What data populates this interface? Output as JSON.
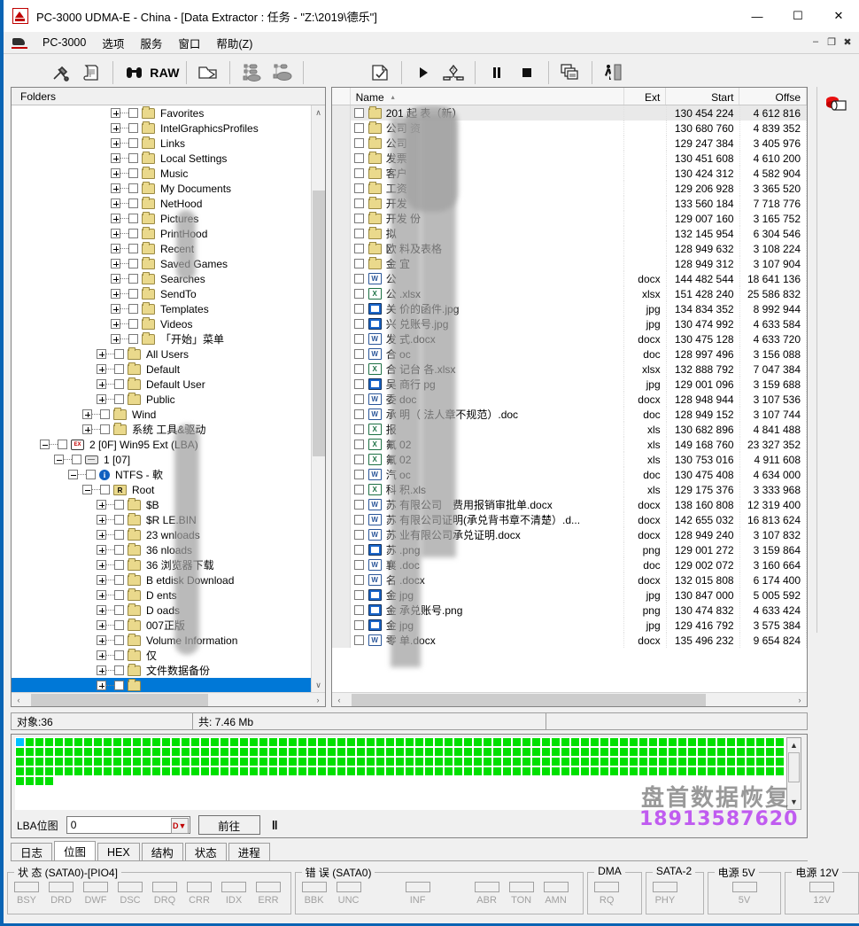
{
  "window": {
    "title": "PC-3000 UDMA-E - China - [Data Extractor : 任务 - \"Z:\\2019\\德乐\"]",
    "app_icon": "pc3000-icon",
    "minimize": "—",
    "maximize": "☐",
    "close": "✕",
    "mdi_minimize": "–",
    "mdi_restore": "❐",
    "mdi_close": "✖"
  },
  "menu": {
    "icon": "pc3000-small-icon",
    "items": [
      {
        "label": "PC-3000",
        "accel": "P"
      },
      {
        "label": "选项",
        "accel": ""
      },
      {
        "label": "服务",
        "accel": ""
      },
      {
        "label": "窗口",
        "accel": ""
      },
      {
        "label": "帮助(Z)",
        "accel": "Z"
      }
    ]
  },
  "toolbar": {
    "buttons": [
      {
        "name": "tools-icon",
        "glyph": "⚒"
      },
      {
        "name": "info-scroll-icon",
        "glyph": "ὍC"
      },
      {
        "name": "sep",
        "glyph": ""
      },
      {
        "name": "binoculars-search-icon",
        "glyph": "AA"
      },
      {
        "name": "raw-button",
        "glyph": "RAW"
      },
      {
        "name": "sep",
        "glyph": ""
      },
      {
        "name": "open-folder-icon",
        "glyph": "⬚"
      },
      {
        "name": "sep",
        "glyph": ""
      },
      {
        "name": "tree-map-icon",
        "glyph": ""
      },
      {
        "name": "tree-map-alt-icon",
        "glyph": ""
      },
      {
        "name": "sep",
        "glyph": ""
      },
      {
        "name": "task-document-icon",
        "glyph": ""
      },
      {
        "name": "sep",
        "glyph": ""
      },
      {
        "name": "play-icon",
        "glyph": "▶"
      },
      {
        "name": "branch-icon",
        "glyph": ""
      },
      {
        "name": "sep",
        "glyph": ""
      },
      {
        "name": "pause-icon",
        "glyph": "‖"
      },
      {
        "name": "stop-icon",
        "glyph": "■"
      },
      {
        "name": "sep",
        "glyph": ""
      },
      {
        "name": "windows-cascade-icon",
        "glyph": ""
      },
      {
        "name": "sep",
        "glyph": ""
      },
      {
        "name": "exit-icon",
        "glyph": ""
      }
    ],
    "raw_label": "RAW"
  },
  "right_rail": {
    "items": [
      {
        "name": "disk-drive-red-icon"
      }
    ]
  },
  "tree": {
    "header": "Folders",
    "rows": [
      {
        "indent": 7,
        "exp": "plus",
        "icon": "folder",
        "label": "Favorites"
      },
      {
        "indent": 7,
        "exp": "plus",
        "icon": "folder",
        "label": "IntelGraphicsProfiles"
      },
      {
        "indent": 7,
        "exp": "plus",
        "icon": "folder",
        "label": "Links"
      },
      {
        "indent": 7,
        "exp": "plus",
        "icon": "folder",
        "label": "Local Settings"
      },
      {
        "indent": 7,
        "exp": "plus",
        "icon": "folder",
        "label": "Music"
      },
      {
        "indent": 7,
        "exp": "plus",
        "icon": "folder",
        "label": "My Documents"
      },
      {
        "indent": 7,
        "exp": "plus",
        "icon": "folder",
        "label": "NetHood"
      },
      {
        "indent": 7,
        "exp": "plus",
        "icon": "folder",
        "label": "Pictures"
      },
      {
        "indent": 7,
        "exp": "plus",
        "icon": "folder",
        "label": "PrintHood"
      },
      {
        "indent": 7,
        "exp": "plus",
        "icon": "folder",
        "label": "Recent"
      },
      {
        "indent": 7,
        "exp": "plus",
        "icon": "folder",
        "label": "Saved Games"
      },
      {
        "indent": 7,
        "exp": "plus",
        "icon": "folder",
        "label": "Searches"
      },
      {
        "indent": 7,
        "exp": "plus",
        "icon": "folder",
        "label": "SendTo"
      },
      {
        "indent": 7,
        "exp": "plus",
        "icon": "folder",
        "label": "Templates"
      },
      {
        "indent": 7,
        "exp": "plus",
        "icon": "folder",
        "label": "Videos"
      },
      {
        "indent": 7,
        "exp": "plus",
        "icon": "folder",
        "label": "「开始」菜单"
      },
      {
        "indent": 6,
        "exp": "plus",
        "icon": "folder",
        "label": "All Users"
      },
      {
        "indent": 6,
        "exp": "plus",
        "icon": "folder",
        "label": "Default"
      },
      {
        "indent": 6,
        "exp": "plus",
        "icon": "folder",
        "label": "Default User"
      },
      {
        "indent": 6,
        "exp": "plus",
        "icon": "folder",
        "label": "Public"
      },
      {
        "indent": 5,
        "exp": "plus",
        "icon": "folder",
        "label": "Wind"
      },
      {
        "indent": 5,
        "exp": "plus",
        "icon": "folder",
        "label": "系统        工具&驱动"
      },
      {
        "indent": 2,
        "exp": "minus",
        "icon": "ext",
        "label": "2 [0F] Win95 Ext          (LBA)"
      },
      {
        "indent": 3,
        "exp": "minus",
        "icon": "drive",
        "label": "1 [07]"
      },
      {
        "indent": 4,
        "exp": "minus",
        "icon": "info",
        "label": "NTFS - 軟"
      },
      {
        "indent": 5,
        "exp": "minus",
        "icon": "rootf",
        "label": "Root"
      },
      {
        "indent": 6,
        "exp": "plus",
        "icon": "folder",
        "label": "$B"
      },
      {
        "indent": 6,
        "exp": "plus",
        "icon": "folder",
        "label": "$R        LE.BIN"
      },
      {
        "indent": 6,
        "exp": "plus",
        "icon": "folder",
        "label": "23        wnloads"
      },
      {
        "indent": 6,
        "exp": "plus",
        "icon": "folder",
        "label": "36        nloads"
      },
      {
        "indent": 6,
        "exp": "plus",
        "icon": "folder",
        "label": "36       浏览器下载"
      },
      {
        "indent": 6,
        "exp": "plus",
        "icon": "folder",
        "label": "B        etdisk Download"
      },
      {
        "indent": 6,
        "exp": "plus",
        "icon": "folder",
        "label": "D        ents"
      },
      {
        "indent": 6,
        "exp": "plus",
        "icon": "folder",
        "label": "D        oads"
      },
      {
        "indent": 6,
        "exp": "plus",
        "icon": "folder",
        "label": "        007正版"
      },
      {
        "indent": 6,
        "exp": "plus",
        "icon": "folder",
        "label": "        Volume Information"
      },
      {
        "indent": 6,
        "exp": "plus",
        "icon": "folder",
        "label": "        仅"
      },
      {
        "indent": 6,
        "exp": "plus",
        "icon": "folder",
        "label": "        文件数据备份"
      },
      {
        "indent": 6,
        "exp": "plus",
        "icon": "folder",
        "label": "",
        "selected": true
      }
    ],
    "scroll_left": "‹",
    "scroll_right": "›",
    "scroll_up": "∧",
    "scroll_down": "∨"
  },
  "filelist": {
    "columns": [
      {
        "key": "name",
        "label": "Name",
        "sort": "▴"
      },
      {
        "key": "ext",
        "label": "Ext",
        "sort": ""
      },
      {
        "key": "start",
        "label": "Start",
        "sort": ""
      },
      {
        "key": "off",
        "label": "Offse",
        "sort": ""
      }
    ],
    "rows": [
      {
        "icon": "folder",
        "name": "201        起        表（新）",
        "ext": "",
        "start": "130 454 224",
        "off": "4 612 816",
        "sel": true
      },
      {
        "icon": "folder",
        "name": "公司        资",
        "ext": "",
        "start": "130 680 760",
        "off": "4 839 352"
      },
      {
        "icon": "folder",
        "name": "公司",
        "ext": "",
        "start": "129 247 384",
        "off": "3 405 976"
      },
      {
        "icon": "folder",
        "name": "发票",
        "ext": "",
        "start": "130 451 608",
        "off": "4 610 200"
      },
      {
        "icon": "folder",
        "name": "客户",
        "ext": "",
        "start": "130 424 312",
        "off": "4 582 904"
      },
      {
        "icon": "folder",
        "name": "工资",
        "ext": "",
        "start": "129 206 928",
        "off": "3 365 520"
      },
      {
        "icon": "folder",
        "name": "开发",
        "ext": "",
        "start": "133 560 184",
        "off": "7 718 776"
      },
      {
        "icon": "folder",
        "name": "开发        份",
        "ext": "",
        "start": "129 007 160",
        "off": "3 165 752"
      },
      {
        "icon": "folder",
        "name": "拟",
        "ext": "",
        "start": "132 145 954",
        "off": "6 304 546"
      },
      {
        "icon": "folder",
        "name": "欧        料及表格",
        "ext": "",
        "start": "128 949 632",
        "off": "3 108 224"
      },
      {
        "icon": "folder",
        "name": "金        宜",
        "ext": "",
        "start": "128 949 312",
        "off": "3 107 904"
      },
      {
        "icon": "doc",
        "name": "公",
        "ext": "docx",
        "start": "144 482 544",
        "off": "18 641 136"
      },
      {
        "icon": "xls",
        "name": "公        .xlsx",
        "ext": "xlsx",
        "start": "151 428 240",
        "off": "25 586 832"
      },
      {
        "icon": "img",
        "name": "关        价的函件.jpg",
        "ext": "jpg",
        "start": "134 834 352",
        "off": "8 992 944"
      },
      {
        "icon": "img",
        "name": "兴        兑账号.jpg",
        "ext": "jpg",
        "start": "130 474 992",
        "off": "4 633 584"
      },
      {
        "icon": "doc",
        "name": "发        式.docx",
        "ext": "docx",
        "start": "130 475 128",
        "off": "4 633 720"
      },
      {
        "icon": "doc",
        "name": "合        oc",
        "ext": "doc",
        "start": "128 997 496",
        "off": "3 156 088"
      },
      {
        "icon": "xls",
        "name": "合        记台        各.xlsx",
        "ext": "xlsx",
        "start": "132 888 792",
        "off": "7 047 384"
      },
      {
        "icon": "img",
        "name": "吴        商行        pg",
        "ext": "jpg",
        "start": "129 001 096",
        "off": "3 159 688"
      },
      {
        "icon": "doc",
        "name": "委        doc",
        "ext": "docx",
        "start": "128 948 944",
        "off": "3 107 536"
      },
      {
        "icon": "doc",
        "name": "承        明（        法人章不规范）.doc",
        "ext": "doc",
        "start": "128 949 152",
        "off": "3 107 744"
      },
      {
        "icon": "xls",
        "name": "报",
        "ext": "xls",
        "start": "130 682 896",
        "off": "4 841 488"
      },
      {
        "icon": "xls",
        "name": "氟        02",
        "ext": "xls",
        "start": "149 168 760",
        "off": "23 327 352"
      },
      {
        "icon": "xls",
        "name": "氟        02",
        "ext": "xls",
        "start": "130 753 016",
        "off": "4 911 608"
      },
      {
        "icon": "doc",
        "name": "汽        oc",
        "ext": "doc",
        "start": "130 475 408",
        "off": "4 634 000"
      },
      {
        "icon": "xls",
        "name": "科        积.xls",
        "ext": "xls",
        "start": "129 175 376",
        "off": "3 333 968"
      },
      {
        "icon": "doc",
        "name": "苏        有限公司　费用报销审批单.docx",
        "ext": "docx",
        "start": "138 160 808",
        "off": "12 319 400"
      },
      {
        "icon": "doc",
        "name": "苏        有限公司证明(承兑背书章不清楚）.d...",
        "ext": "docx",
        "start": "142 655 032",
        "off": "16 813 624"
      },
      {
        "icon": "doc",
        "name": "苏        业有限公司承兑证明.docx",
        "ext": "docx",
        "start": "128 949 240",
        "off": "3 107 832"
      },
      {
        "icon": "img",
        "name": "苏        .png",
        "ext": "png",
        "start": "129 001 272",
        "off": "3 159 864"
      },
      {
        "icon": "doc",
        "name": "襄        .doc",
        "ext": "doc",
        "start": "129 002 072",
        "off": "3 160 664"
      },
      {
        "icon": "doc",
        "name": "名        .docx",
        "ext": "docx",
        "start": "132 015 808",
        "off": "6 174 400"
      },
      {
        "icon": "img",
        "name": "金        jpg",
        "ext": "jpg",
        "start": "130 847 000",
        "off": "5 005 592"
      },
      {
        "icon": "img",
        "name": "金        承兑账号.png",
        "ext": "png",
        "start": "130 474 832",
        "off": "4 633 424"
      },
      {
        "icon": "img",
        "name": "金        jpg",
        "ext": "jpg",
        "start": "129 416 792",
        "off": "3 575 384"
      },
      {
        "icon": "doc",
        "name": "零        单.docx",
        "ext": "docx",
        "start": "135 496 232",
        "off": "9 654 824"
      }
    ]
  },
  "statusbar": {
    "objects": "对象:36",
    "total": "共: 7.46 Mb",
    "extra": ""
  },
  "bitmap": {
    "lba_label": "LBA位图",
    "lba_value": "0",
    "lba_placeholder": "0",
    "dec_button": "D",
    "goto_button": "前往",
    "pause_icon": "‖",
    "scroll_up": "▲",
    "scroll_down": "▼",
    "green_cells": 320,
    "cyan_index": 0,
    "colors": {
      "good": "#00e000",
      "current": "#00c0ff"
    }
  },
  "watermark": {
    "company": "盘首数据恢复",
    "phone": "18913587620"
  },
  "tabs": [
    {
      "label": "日志",
      "active": false
    },
    {
      "label": "位图",
      "active": true
    },
    {
      "label": "HEX",
      "active": false
    },
    {
      "label": "结构",
      "active": false
    },
    {
      "label": "状态",
      "active": false
    },
    {
      "label": "进程",
      "active": false
    }
  ],
  "indicators": {
    "status_group": {
      "title": "状 态 (SATA0)-[PIO4]",
      "leds": [
        "BSY",
        "DRD",
        "DWF",
        "DSC",
        "DRQ",
        "CRR",
        "IDX",
        "ERR"
      ]
    },
    "error_group": {
      "title": "错 误 (SATA0)",
      "leds": [
        "BBK",
        "UNC",
        "",
        "INF",
        "",
        "ABR",
        "TON",
        "AMN"
      ]
    },
    "dma_group": {
      "title": "DMA",
      "leds": [
        "RQ"
      ]
    },
    "sata_group": {
      "title": "SATA-2",
      "leds": [
        "PHY"
      ]
    },
    "power5_group": {
      "title": "电源 5V",
      "leds": [
        "5V"
      ]
    },
    "power12_group": {
      "title": "电源 12V",
      "leds": [
        "12V"
      ]
    }
  }
}
